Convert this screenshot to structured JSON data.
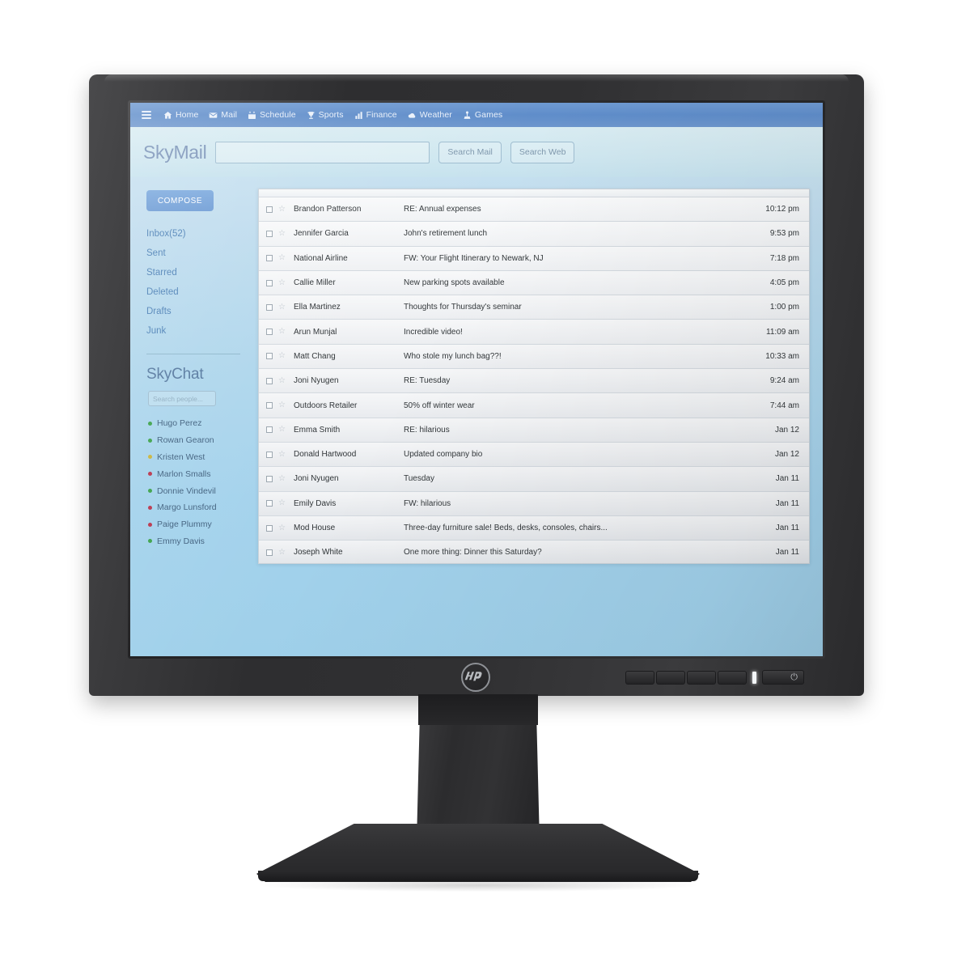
{
  "device": {
    "brand": "hp",
    "power_icon": "power-icon",
    "osd_button_count": 4
  },
  "nav": {
    "menu_icon": "hamburger-menu-icon",
    "items": [
      {
        "label": "Home",
        "icon": "house-icon"
      },
      {
        "label": "Mail",
        "icon": "envelope-icon"
      },
      {
        "label": "Schedule",
        "icon": "calendar-icon"
      },
      {
        "label": "Sports",
        "icon": "trophy-icon"
      },
      {
        "label": "Finance",
        "icon": "bar-chart-icon"
      },
      {
        "label": "Weather",
        "icon": "cloud-icon"
      },
      {
        "label": "Games",
        "icon": "joystick-icon"
      }
    ]
  },
  "brandbar": {
    "logo": "SkyMail",
    "search_value": "",
    "search_placeholder": "",
    "search_mail_label": "Search Mail",
    "search_web_label": "Search Web"
  },
  "sidebar": {
    "compose_label": "COMPOSE",
    "folders": [
      {
        "label": "Inbox(52)"
      },
      {
        "label": "Sent"
      },
      {
        "label": "Starred"
      },
      {
        "label": "Deleted"
      },
      {
        "label": "Drafts"
      },
      {
        "label": "Junk"
      }
    ],
    "chat": {
      "title": "SkyChat",
      "search_value": "",
      "search_placeholder": "Search people...",
      "status_colors": {
        "online": "#3aa147",
        "away": "#c9b339",
        "busy": "#b8334a"
      },
      "people": [
        {
          "name": "Hugo Perez",
          "status": "online"
        },
        {
          "name": "Rowan Gearon",
          "status": "online"
        },
        {
          "name": "Kristen West",
          "status": "away"
        },
        {
          "name": "Marlon Smalls",
          "status": "busy"
        },
        {
          "name": "Donnie Vindevil",
          "status": "online"
        },
        {
          "name": "Margo Lunsford",
          "status": "busy"
        },
        {
          "name": "Paige Plummy",
          "status": "busy"
        },
        {
          "name": "Emmy Davis",
          "status": "online"
        }
      ]
    }
  },
  "mail": {
    "rows": [
      {
        "sender": "Brandon Patterson",
        "subject": "RE: Annual expenses",
        "time": "10:12 pm"
      },
      {
        "sender": "Jennifer Garcia",
        "subject": "John's retirement lunch",
        "time": "9:53 pm"
      },
      {
        "sender": "National Airline",
        "subject": "FW: Your Flight Itinerary to Newark, NJ",
        "time": "7:18 pm"
      },
      {
        "sender": "Callie Miller",
        "subject": "New parking spots available",
        "time": "4:05 pm"
      },
      {
        "sender": "Ella Martinez",
        "subject": "Thoughts for Thursday's seminar",
        "time": "1:00 pm"
      },
      {
        "sender": "Arun Munjal",
        "subject": "Incredible video!",
        "time": "11:09 am"
      },
      {
        "sender": "Matt Chang",
        "subject": "Who stole my lunch bag??!",
        "time": "10:33 am"
      },
      {
        "sender": "Joni Nyugen",
        "subject": "RE: Tuesday",
        "time": "9:24 am"
      },
      {
        "sender": "Outdoors Retailer",
        "subject": "50% off winter wear",
        "time": "7:44 am"
      },
      {
        "sender": "Emma Smith",
        "subject": "RE: hilarious",
        "time": "Jan 12"
      },
      {
        "sender": "Donald Hartwood",
        "subject": "Updated company bio",
        "time": "Jan 12"
      },
      {
        "sender": "Joni Nyugen",
        "subject": "Tuesday",
        "time": "Jan 11"
      },
      {
        "sender": "Emily Davis",
        "subject": "FW: hilarious",
        "time": "Jan 11"
      },
      {
        "sender": "Mod House",
        "subject": "Three-day furniture sale! Beds, desks, consoles, chairs...",
        "time": "Jan 11"
      },
      {
        "sender": "Joseph White",
        "subject": "One more thing: Dinner this Saturday?",
        "time": "Jan 11"
      }
    ],
    "star_glyph": "☆"
  },
  "colors": {
    "nav_blue": "#5f8dca",
    "compose_blue": "#6b9ad4",
    "folder_link": "#4a7fb5",
    "screen_bg_top": "#cfe6f2",
    "screen_bg_bottom": "#9fd0ea"
  }
}
